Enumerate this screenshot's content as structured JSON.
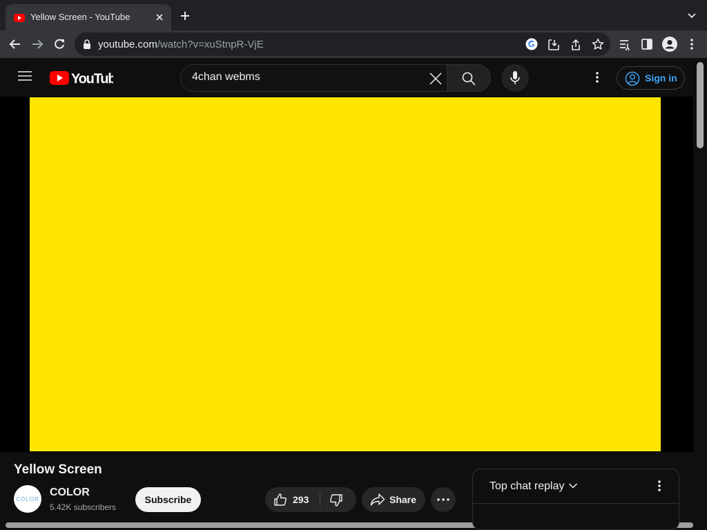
{
  "browser": {
    "tab_title": "Yellow Screen - YouTube",
    "url_host": "youtube.com",
    "url_path": "/watch?v=xuStnpR-VjE"
  },
  "youtube": {
    "logo_text": "YouTube",
    "search_value": "4chan webms",
    "sign_in_label": "Sign in"
  },
  "video": {
    "title": "Yellow Screen",
    "frame_color": "#ffe500",
    "channel_name": "COLOR",
    "avatar_text": "COLOR",
    "subscribers": "5.42K subscribers",
    "subscribe_label": "Subscribe",
    "like_count": "293",
    "share_label": "Share"
  },
  "chat": {
    "title": "Top chat replay"
  },
  "colors": {
    "accent": "#3ea6ff",
    "brand_red": "#ff0000",
    "background": "#0f0f0f"
  }
}
